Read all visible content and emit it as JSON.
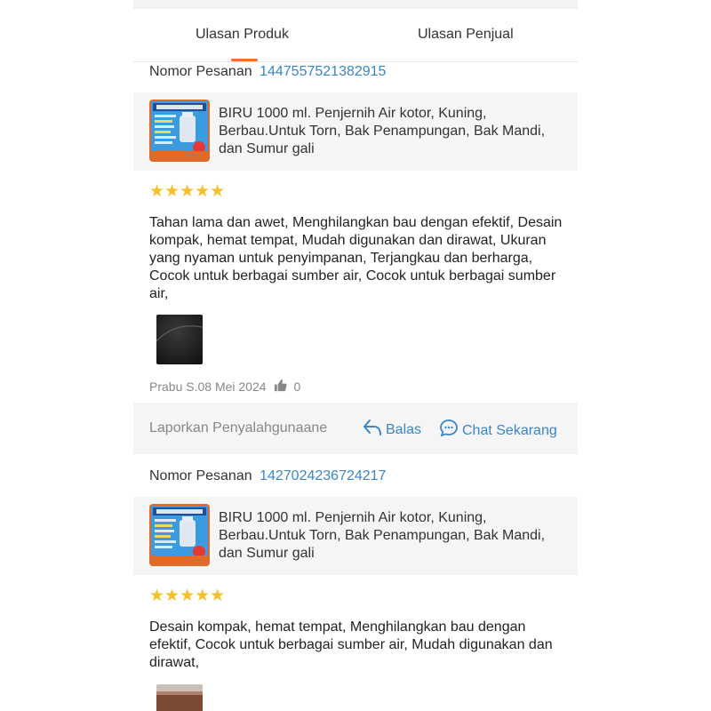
{
  "tabs": {
    "produk": "Ulasan Produk",
    "penjual": "Ulasan Penjual"
  },
  "colors": {
    "accent": "#ee7430",
    "link": "#3a86c8",
    "star": "#f6c02c"
  },
  "reviews": [
    {
      "order_label": "Nomor Pesanan",
      "order_number": "1447557521382915",
      "product_title": "BIRU 1000 ml. Penjernih Air kotor, Kuning, Berbau.Untuk Torn, Bak Penampungan, Bak Mandi, dan Sumur gali",
      "rating": 5,
      "stars": "★★★★★",
      "text": "Tahan lama dan awet, Menghilangkan bau dengan efektif, Desain kompak, hemat tempat, Mudah digunakan dan dirawat, Ukuran yang nyaman untuk penyimpanan, Terjangkau dan berharga, Cocok untuk berbagai sumber air, Cocok untuk berbagai sumber air,",
      "author_date": "Prabu S.08 Mei 2024",
      "likes": "0",
      "report": "Laporkan Penyalahgunaane",
      "reply": "Balas",
      "chat": "Chat Sekarang"
    },
    {
      "order_label": "Nomor Pesanan",
      "order_number": "1427024236724217",
      "product_title": "BIRU 1000 ml. Penjernih Air kotor, Kuning, Berbau.Untuk Torn, Bak Penampungan, Bak Mandi, dan Sumur gali",
      "rating": 5,
      "stars": "★★★★★",
      "text": "Desain kompak, hemat tempat, Menghilangkan bau dengan efektif, Cocok untuk berbagai sumber air, Mudah digunakan dan dirawat,"
    }
  ]
}
